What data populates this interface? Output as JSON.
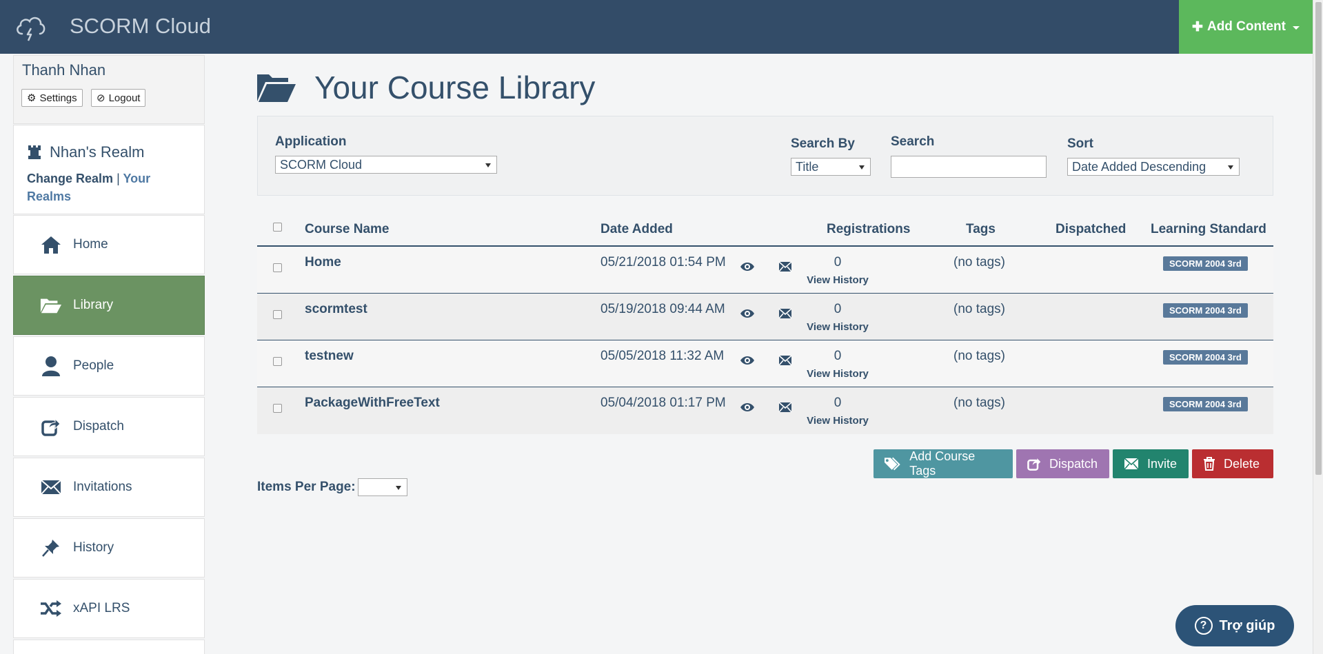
{
  "header": {
    "app_title": "SCORM Cloud",
    "add_content_label": "Add Content"
  },
  "user": {
    "name": "Thanh Nhan",
    "settings_label": "Settings",
    "logout_label": "Logout"
  },
  "realm": {
    "name": "Nhan's Realm",
    "change_label": "Change Realm",
    "separator": "|",
    "your_realms_label": "Your Realms"
  },
  "nav": [
    {
      "label": "Home",
      "icon": "home-icon",
      "active": false
    },
    {
      "label": "Library",
      "icon": "folder-open-icon",
      "active": true
    },
    {
      "label": "People",
      "icon": "person-icon",
      "active": false
    },
    {
      "label": "Dispatch",
      "icon": "share-icon",
      "active": false
    },
    {
      "label": "Invitations",
      "icon": "envelope-icon",
      "active": false
    },
    {
      "label": "History",
      "icon": "pushpin-icon",
      "active": false
    },
    {
      "label": "xAPI LRS",
      "icon": "shuffle-icon",
      "active": false
    }
  ],
  "page": {
    "title": "Your Course Library"
  },
  "filters": {
    "application_label": "Application",
    "application_value": "SCORM Cloud",
    "search_by_label": "Search By",
    "search_by_value": "Title",
    "search_label": "Search",
    "search_value": "",
    "sort_label": "Sort",
    "sort_value": "Date Added Descending"
  },
  "table": {
    "headers": {
      "course_name": "Course Name",
      "date_added": "Date Added",
      "registrations": "Registrations",
      "tags": "Tags",
      "dispatched": "Dispatched",
      "learning_standard": "Learning Standard"
    },
    "rows": [
      {
        "name": "Home",
        "date": "05/21/2018 01:54 PM",
        "registrations": "0",
        "view_history": "View History",
        "tags": "(no tags)",
        "dispatched": "",
        "standard": "SCORM 2004 3rd"
      },
      {
        "name": "scormtest",
        "date": "05/19/2018 09:44 AM",
        "registrations": "0",
        "view_history": "View History",
        "tags": "(no tags)",
        "dispatched": "",
        "standard": "SCORM 2004 3rd"
      },
      {
        "name": "testnew",
        "date": "05/05/2018 11:32 AM",
        "registrations": "0",
        "view_history": "View History",
        "tags": "(no tags)",
        "dispatched": "",
        "standard": "SCORM 2004 3rd"
      },
      {
        "name": "PackageWithFreeText",
        "date": "05/04/2018 01:17 PM",
        "registrations": "0",
        "view_history": "View History",
        "tags": "(no tags)",
        "dispatched": "",
        "standard": "SCORM 2004 3rd"
      }
    ]
  },
  "actions": {
    "add_tags_label": "Add Course Tags",
    "dispatch_label": "Dispatch",
    "invite_label": "Invite",
    "delete_label": "Delete"
  },
  "pagination": {
    "items_per_page_label": "Items Per Page:",
    "items_per_page_value": ""
  },
  "help": {
    "label": "Trợ giúp"
  },
  "colors": {
    "header_bg": "#334c68",
    "add_content": "#5cb85c",
    "nav_active": "#6b9362",
    "text_primary": "#34506b",
    "badge": "#59799a",
    "tags_btn": "#4f96a1",
    "dispatch_btn": "#9f75b1",
    "invite_btn": "#22846e",
    "delete_btn": "#ba2e31",
    "help_btn": "#2c5377"
  }
}
